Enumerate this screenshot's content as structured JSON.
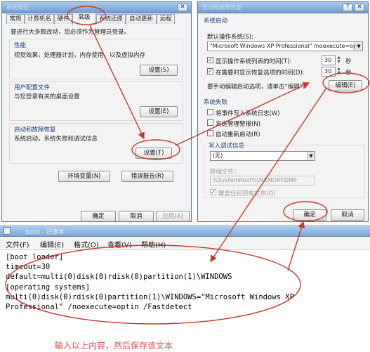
{
  "sysprop": {
    "title": "系统属性",
    "tabs": [
      "常规",
      "计算机名",
      "硬件",
      "高级",
      "系统还原",
      "自动更新",
      "远程"
    ],
    "intro": "要进行大多数改动，您必须作为管理员登录。",
    "performance": {
      "title": "性能",
      "desc": "视觉效果，处理器计划，内存使用，以及虚拟内存",
      "button": "设置(S)"
    },
    "profiles": {
      "title": "用户配置文件",
      "desc": "与您登录有关的桌面设置",
      "button": "设置(E)"
    },
    "startup": {
      "title": "启动和故障恢复",
      "desc": "系统启动，系统失败和调试信息",
      "button": "设置(T)"
    },
    "env_button": "环境变量(N)",
    "error_button": "错误报告(R)",
    "ok": "确定",
    "cancel": "取消",
    "apply": "应用(A)"
  },
  "startup_dialog": {
    "title": "启动和故障恢复",
    "system_startup": "系统启动",
    "default_os_label": "默认操作系统(S):",
    "default_os_value": "\"Microsoft Windows XP Professional\" /noexecute=optin",
    "show_list_label": "显示操作系统列表的时间(T):",
    "show_list_value": "30",
    "show_recovery_label": "在需要时显示恢复选项的时间(D):",
    "show_recovery_value": "30",
    "seconds": "秒",
    "edit_hint": "要手动编辑启动选项，请单击“编辑”。",
    "edit_button": "编辑(E)",
    "system_failure": "系统失败",
    "write_event": "将事件写入系统日志(W)",
    "send_alert": "发送管理警报(N)",
    "auto_restart": "自动重新启动(R)",
    "debug_info": "写入调试信息",
    "debug_value": "(无)",
    "dump_label": "转储文件：",
    "dump_value": "%SystemRoot%\\MEMORY.DMP",
    "overwrite": "覆盖任何现有文件(O)",
    "ok": "确定",
    "cancel": "取消"
  },
  "notepad": {
    "title": "boot - 记事本",
    "menu": [
      "文件(F)",
      "编辑(E)",
      "格式(O)",
      "查看(V)",
      "帮助(H)"
    ],
    "lines": [
      "[boot loader]",
      "timeout=30",
      "default=multi(0)disk(0)rdisk(0)partition(1)\\WINDOWS",
      "[operating systems]",
      "multi(0)disk(0)rdisk(0)partition(1)\\WINDOWS=\"Microsoft Windows XP",
      "Professional\" /noexecute=optin /Fastdetect"
    ],
    "caption": "输入以上内容，然后保存该文本"
  },
  "colors": {
    "annotation": "#c0392b",
    "caption": "#d9534f",
    "titlebar": "#7ea9d6"
  }
}
